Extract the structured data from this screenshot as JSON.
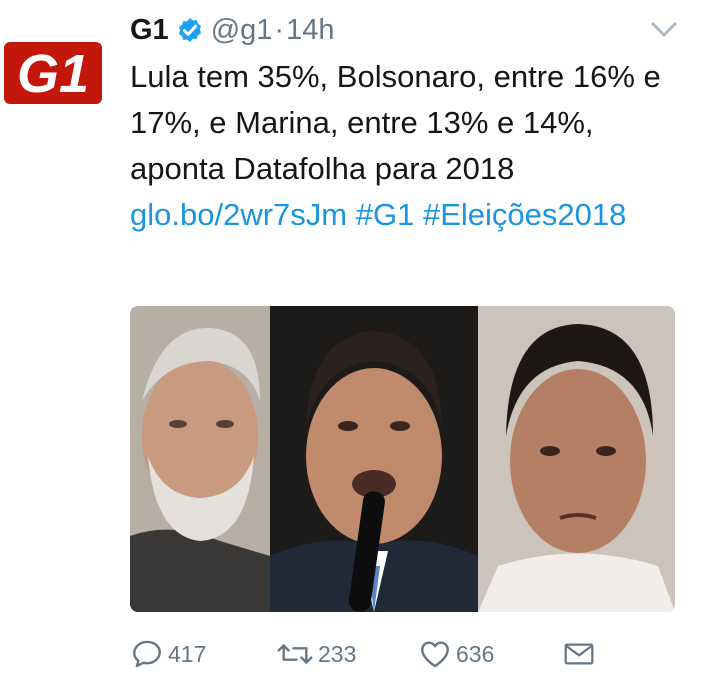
{
  "tweet": {
    "display_name": "G1",
    "handle": "@g1",
    "separator": "·",
    "time": "14h",
    "text_plain": "Lula tem 35%, Bolsonaro, entre 16% e 17%, e Marina, entre 13% e 14%, aponta Datafolha para 2018",
    "link": "glo.bo/2wr7sJm",
    "hashtag1": "#G1",
    "hashtag2": "#Eleições2018"
  },
  "avatar": {
    "logo_text": "G1",
    "color": "#c4170c"
  },
  "actions": {
    "reply_count": "417",
    "retweet_count": "233",
    "like_count": "636"
  },
  "icons": {
    "verified": "verified-badge-icon",
    "more": "chevron-down-icon",
    "reply": "reply-icon",
    "retweet": "retweet-icon",
    "like": "heart-icon",
    "dm": "envelope-icon"
  },
  "colors": {
    "link": "#1b95e0",
    "muted": "#657786",
    "verified": "#1da1f2",
    "brand": "#c4170c"
  }
}
